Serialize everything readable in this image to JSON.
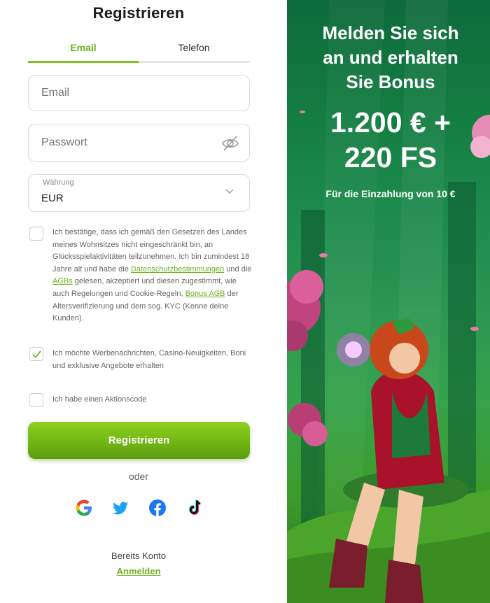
{
  "form": {
    "title": "Registrieren",
    "tabs": [
      {
        "label": "Email",
        "active": true
      },
      {
        "label": "Telefon",
        "active": false
      }
    ],
    "email": {
      "placeholder": "Email",
      "value": ""
    },
    "password": {
      "placeholder": "Passwort",
      "value": ""
    },
    "currency": {
      "label": "Währung",
      "value": "EUR"
    },
    "consent": {
      "checked": false,
      "text_before": "Ich bestätige, dass ich gemäß den Gesetzen des Landes meines Wohnsitzes nicht eingeschränkt bin, an Glücksspielaktivitäten teilzunehmen. Ich bin zumindest 18 Jahre alt und habe die",
      "link_privacy": "Datenschutzbestimmungen",
      "text_mid1": "und die",
      "link_terms": "AGBs",
      "text_mid2": "gelesen, akzeptiert und diesen zugestimmt, wie auch Regelungen und Cookie-Regeln,",
      "link_bonus": "Bonus AGB",
      "text_after": "der Altersverifizierung und dem sog. KYC (Kenne deine Kunden)."
    },
    "marketing": {
      "checked": true,
      "text": "Ich möchte Werbenachrichten, Casino-Neuigkeiten, Boni und exklusive Angebote erhalten"
    },
    "promo_code": {
      "checked": false,
      "text": "Ich habe einen Aktionscode"
    },
    "submit_label": "Registrieren",
    "or_label": "oder",
    "social": [
      "google-icon",
      "twitter-icon",
      "facebook-icon",
      "tiktok-icon"
    ],
    "existing_account": "Bereits Konto",
    "login_link": "Anmelden"
  },
  "promo": {
    "headline_line1": "Melden Sie sich",
    "headline_line2": "an und erhalten",
    "headline_line3": "Sie Bonus",
    "amount_line1": "1.200 € +",
    "amount_line2": "220 FS",
    "subline": "Für die Einzahlung von 10 €"
  },
  "colors": {
    "accent": "#7cc41f",
    "accent_text": "#6cb31e",
    "promo_bg": "#137c41"
  }
}
